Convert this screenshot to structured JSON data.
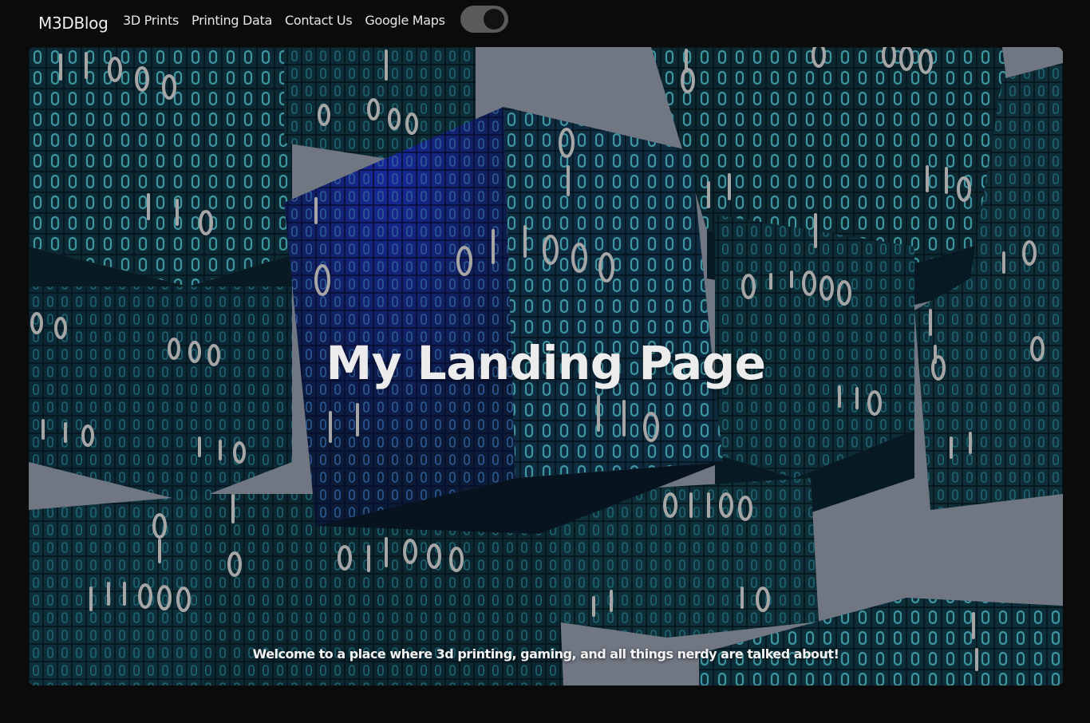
{
  "navbar": {
    "brand": "M3DBlog",
    "links": [
      "3D Prints",
      "Printing Data",
      "Contact Us",
      "Google Maps"
    ],
    "toggle_icon": "dark-mode-toggle"
  },
  "hero": {
    "title": "My Landing Page",
    "tagline": "Welcome to a place where 3d printing, gaming, and all things nerdy are talked about!",
    "image_icon": "binary-cubes-image"
  },
  "colors": {
    "page_background": "#0b0b0b",
    "nav_text": "#e6e6e6",
    "toggle_track": "#5a5a5a",
    "cube_dark": "#123846",
    "cube_blue": "#1a2f7a",
    "digit_teal": "#4fc3d6",
    "digit_white": "#e8e8e8",
    "sky": "#9aa4b4"
  }
}
